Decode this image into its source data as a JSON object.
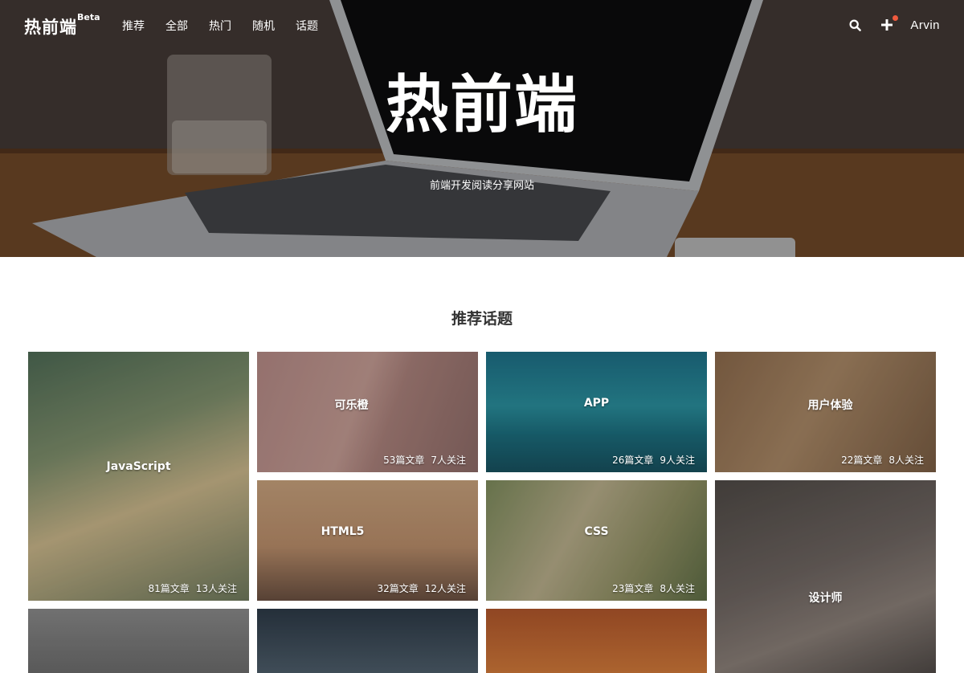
{
  "nav": {
    "logo": "热前端",
    "beta": "Beta",
    "links": [
      "推荐",
      "全部",
      "热门",
      "随机",
      "话题"
    ],
    "username": "Arvin",
    "search_icon": "search-icon",
    "add_icon": "plus-icon",
    "notify_color": "#f05a3e"
  },
  "hero": {
    "title": "热前端",
    "subtitle": "前端开发阅读分享网站"
  },
  "section": {
    "title": "推荐话题"
  },
  "topics": [
    {
      "name": "JavaScript",
      "articles": "81篇文章",
      "followers": "13人关注"
    },
    {
      "name": "可乐橙",
      "articles": "53篇文章",
      "followers": "7人关注"
    },
    {
      "name": "APP",
      "articles": "26篇文章",
      "followers": "9人关注"
    },
    {
      "name": "用户体验",
      "articles": "22篇文章",
      "followers": "8人关注"
    },
    {
      "name": "HTML5",
      "articles": "32篇文章",
      "followers": "12人关注"
    },
    {
      "name": "CSS",
      "articles": "23篇文章",
      "followers": "8人关注"
    },
    {
      "name": "设计师"
    }
  ]
}
